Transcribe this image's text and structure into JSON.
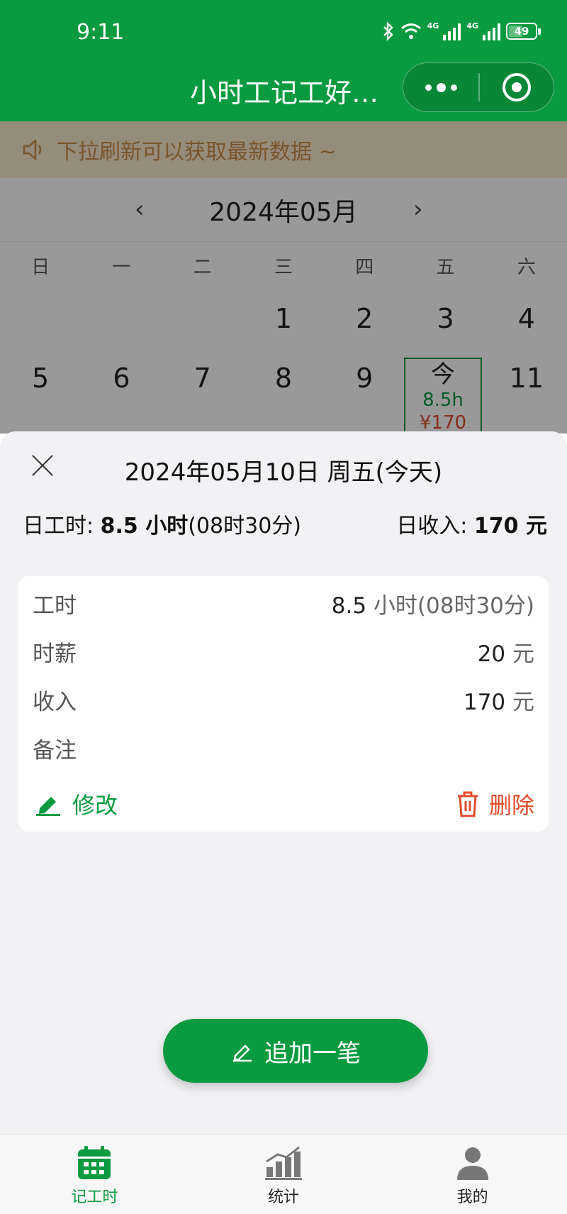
{
  "status_bar": {
    "time": "9:11",
    "network": "4G",
    "battery": "49"
  },
  "title_bar": {
    "title": "小时工记工好…",
    "more_icon": "more-dots-icon",
    "close_icon": "target-circle-icon"
  },
  "colors": {
    "brand": "#0a9a3f",
    "income": "#e14b2a",
    "notice_bg": "#fbe9cf"
  },
  "notice": {
    "text": "下拉刷新可以获取最新数据 ~"
  },
  "calendar": {
    "month": "2024年05月",
    "weekdays": [
      "日",
      "一",
      "二",
      "三",
      "四",
      "五",
      "六"
    ],
    "row1": [
      "",
      "",
      "",
      "1",
      "2",
      "3",
      "4"
    ],
    "row2": [
      "5",
      "6",
      "7",
      "8",
      "9",
      "",
      "11"
    ],
    "today": {
      "label": "今",
      "hours": "8.5h",
      "income": "¥170"
    }
  },
  "sheet": {
    "title": "2024年05月10日 周五(今天)",
    "day_hours_label": "日工时: ",
    "day_hours_value": "8.5 小时",
    "day_hours_detail": "(08时30分)",
    "day_income_label": "日收入: ",
    "day_income_value": "170 元",
    "rows": {
      "hours": {
        "label": "工时",
        "value": "8.5",
        "unit": " 小时(08时30分)"
      },
      "rate": {
        "label": "时薪",
        "value": "20",
        "unit": " 元"
      },
      "income": {
        "label": "收入",
        "value": "170",
        "unit": " 元"
      },
      "note": {
        "label": "备注",
        "value": "",
        "unit": ""
      }
    },
    "edit_label": "修改",
    "delete_label": "删除"
  },
  "add_button": {
    "label": "追加一笔"
  },
  "tabs": [
    {
      "label": "记工时",
      "icon": "calendar-icon",
      "active": true
    },
    {
      "label": "统计",
      "icon": "bar-chart-icon",
      "active": false
    },
    {
      "label": "我的",
      "icon": "user-icon",
      "active": false
    }
  ]
}
